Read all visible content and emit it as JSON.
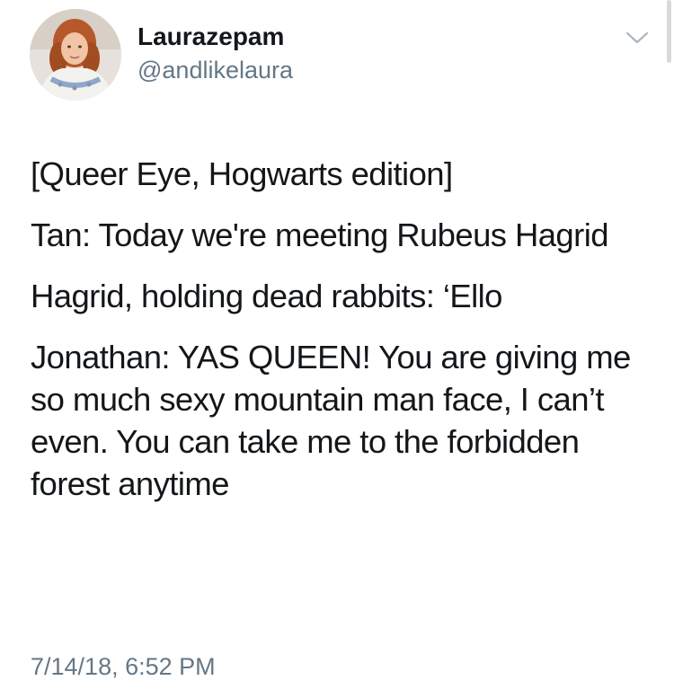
{
  "tweet": {
    "author": {
      "name": "Laurazepam",
      "handle": "@andlikelaura"
    },
    "menu_icon": "chevron-down-icon",
    "paragraphs": [
      "[Queer Eye, Hogwarts edition]",
      "Tan: Today we're meeting Rubeus Hagrid",
      "Hagrid, holding dead rabbits: ‘Ello",
      "Jonathan: YAS QUEEN! You are giving me so much sexy mountain man face, I can’t even. You can take me to the forbidden forest anytime"
    ],
    "timestamp": "7/14/18, 6:52 PM"
  },
  "colors": {
    "text_primary": "#14171a",
    "text_secondary": "#657786",
    "caret": "#aab8c2",
    "background": "#ffffff"
  }
}
